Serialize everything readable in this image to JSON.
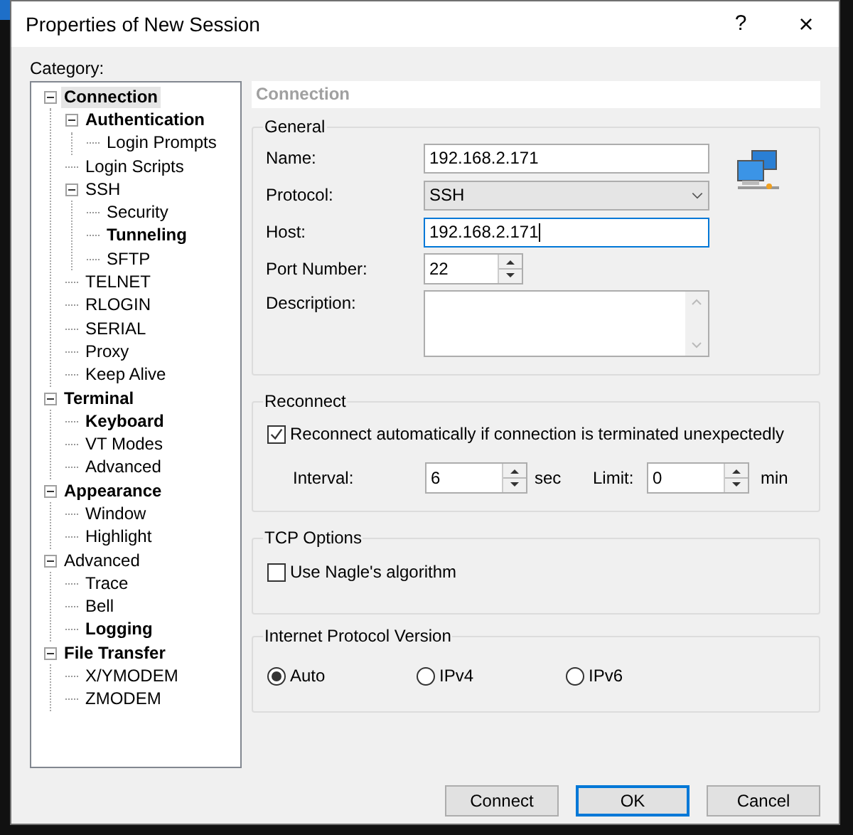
{
  "window": {
    "title": "Properties of New Session",
    "help_button": "?",
    "close_button": "×"
  },
  "category_label": "Category:",
  "tree": [
    {
      "label": "Connection",
      "bold": true,
      "selected": true,
      "expanded": true,
      "children": [
        {
          "label": "Authentication",
          "bold": true,
          "selected": false,
          "expanded": true,
          "children": [
            {
              "label": "Login Prompts",
              "bold": false,
              "selected": false
            }
          ]
        },
        {
          "label": "Login Scripts",
          "bold": false,
          "selected": false
        },
        {
          "label": "SSH",
          "bold": false,
          "selected": false,
          "expanded": true,
          "children": [
            {
              "label": "Security",
              "bold": false,
              "selected": false
            },
            {
              "label": "Tunneling",
              "bold": true,
              "selected": false
            },
            {
              "label": "SFTP",
              "bold": false,
              "selected": false
            }
          ]
        },
        {
          "label": "TELNET",
          "bold": false,
          "selected": false
        },
        {
          "label": "RLOGIN",
          "bold": false,
          "selected": false
        },
        {
          "label": "SERIAL",
          "bold": false,
          "selected": false
        },
        {
          "label": "Proxy",
          "bold": false,
          "selected": false
        },
        {
          "label": "Keep Alive",
          "bold": false,
          "selected": false
        }
      ]
    },
    {
      "label": "Terminal",
      "bold": true,
      "selected": false,
      "expanded": true,
      "children": [
        {
          "label": "Keyboard",
          "bold": true,
          "selected": false
        },
        {
          "label": "VT Modes",
          "bold": false,
          "selected": false
        },
        {
          "label": "Advanced",
          "bold": false,
          "selected": false
        }
      ]
    },
    {
      "label": "Appearance",
      "bold": true,
      "selected": false,
      "expanded": true,
      "children": [
        {
          "label": "Window",
          "bold": false,
          "selected": false
        },
        {
          "label": "Highlight",
          "bold": false,
          "selected": false
        }
      ]
    },
    {
      "label": "Advanced",
      "bold": false,
      "selected": false,
      "expanded": true,
      "children": [
        {
          "label": "Trace",
          "bold": false,
          "selected": false
        },
        {
          "label": "Bell",
          "bold": false,
          "selected": false
        },
        {
          "label": "Logging",
          "bold": true,
          "selected": false
        }
      ]
    },
    {
      "label": "File Transfer",
      "bold": true,
      "selected": false,
      "expanded": true,
      "children": [
        {
          "label": "X/YMODEM",
          "bold": false,
          "selected": false
        },
        {
          "label": "ZMODEM",
          "bold": false,
          "selected": false
        }
      ]
    }
  ],
  "page_header": "Connection",
  "general": {
    "title": "General",
    "fields": [
      {
        "kind": "text",
        "label": "Name:",
        "value": "192.168.2.171",
        "focused": false
      },
      {
        "kind": "select",
        "label": "Protocol:",
        "value": "SSH"
      },
      {
        "kind": "text",
        "label": "Host:",
        "value": "192.168.2.171",
        "focused": true
      },
      {
        "kind": "spin",
        "label": "Port Number:",
        "value": "22"
      },
      {
        "kind": "textarea",
        "label": "Description:"
      }
    ]
  },
  "reconnect": {
    "title": "Reconnect",
    "checkbox": {
      "label": "Reconnect automatically if connection is terminated unexpectedly",
      "checked": true
    },
    "interval": {
      "label": "Interval:",
      "value": "6",
      "unit": "sec"
    },
    "limit": {
      "label": "Limit:",
      "value": "0",
      "unit": "min"
    }
  },
  "tcp": {
    "title": "TCP Options",
    "checkbox": {
      "label": "Use Nagle's algorithm",
      "checked": false
    }
  },
  "ip_version": {
    "title": "Internet Protocol Version",
    "options": [
      {
        "label": "Auto",
        "selected": true
      },
      {
        "label": "IPv4",
        "selected": false
      },
      {
        "label": "IPv6",
        "selected": false
      }
    ]
  },
  "buttons": [
    {
      "label": "Connect",
      "default": false
    },
    {
      "label": "OK",
      "default": true
    },
    {
      "label": "Cancel",
      "default": false
    }
  ]
}
